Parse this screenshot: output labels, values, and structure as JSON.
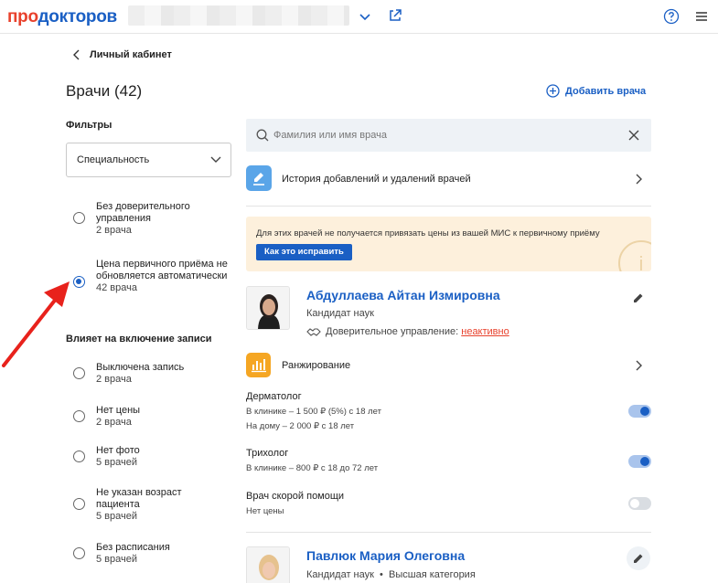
{
  "topbar": {
    "logo_part1": "про",
    "logo_part2": "докторов"
  },
  "header": {
    "back_label": "Личный кабинет",
    "title": "Врачи (42)",
    "add_doctor_label": "Добавить врача"
  },
  "filters": {
    "title": "Фильтры",
    "specialty_placeholder": "Специальность",
    "options": [
      {
        "label": "Без доверительного управления",
        "count": "2 врача",
        "checked": false
      },
      {
        "label": "Цена первичного приёма не обновляется автоматически",
        "count": "42 врача",
        "checked": true
      }
    ],
    "section2_title": "Влияет на включение записи",
    "options2": [
      {
        "label": "Выключена запись",
        "count": "2 врача"
      },
      {
        "label": "Нет цены",
        "count": "2 врача"
      },
      {
        "label": "Нет фото",
        "count": "5 врачей"
      },
      {
        "label": "Не указан возраст пациента",
        "count": "5 врачей"
      },
      {
        "label": "Без расписания",
        "count": "5 врачей"
      }
    ]
  },
  "search": {
    "placeholder": "Фамилия или имя врача"
  },
  "history": {
    "label": "История добавлений и удалений врачей"
  },
  "warning": {
    "text": "Для этих врачей не получается привязать цены из вашей МИС к первичному приёму",
    "button": "Как это исправить",
    "deco_glyph": "i"
  },
  "doctors": [
    {
      "name": "Абдуллаева Айтан Измировна",
      "degree": "Кандидат наук",
      "trust_label": "Доверительное управление:",
      "trust_status": "неактивно",
      "ranking_label": "Ранжирование",
      "specialties": [
        {
          "name": "Дерматолог",
          "lines": [
            "В клинике – 1 500 ₽ (5%) с 18 лет",
            "На дому – 2 000 ₽ с 18 лет"
          ],
          "enabled": true
        },
        {
          "name": "Трихолог",
          "lines": [
            "В клинике – 800 ₽ с 18 до 72 лет"
          ],
          "enabled": true
        },
        {
          "name": "Врач скорой помощи",
          "lines": [
            "Нет цены"
          ],
          "enabled": false
        }
      ]
    },
    {
      "name": "Павлюк Мария Олеговна",
      "degree": "Кандидат наук",
      "category": "Высшая категория"
    }
  ],
  "colors": {
    "accent": "#1a5fc4",
    "brand_red": "#e8412c",
    "warning_bg": "#fdf0dc",
    "history_badge": "#5aa5e8",
    "ranking_badge": "#f5a623"
  }
}
